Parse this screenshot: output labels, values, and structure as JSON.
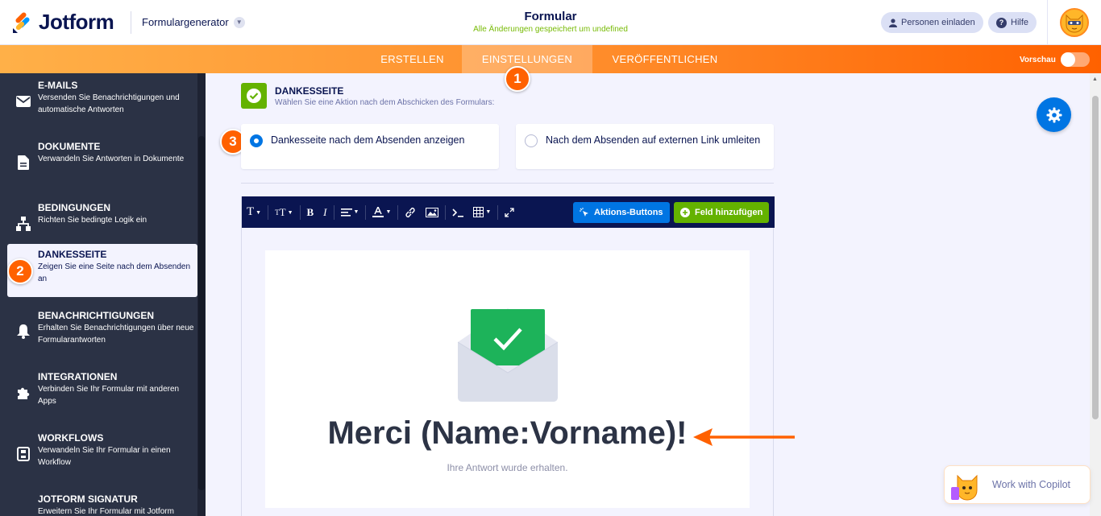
{
  "app": {
    "brand": "Jotform",
    "breadcrumb": "Formulargenerator"
  },
  "header": {
    "title": "Formular",
    "status": "Alle Änderungen gespeichert um undefined",
    "invite": "Personen einladen",
    "help": "Hilfe"
  },
  "nav": {
    "tabs": [
      {
        "label": "ERSTELLEN"
      },
      {
        "label": "EINSTELLUNGEN"
      },
      {
        "label": "VERÖFFENTLICHEN"
      }
    ],
    "preview": "Vorschau"
  },
  "callouts": [
    "1",
    "2",
    "3"
  ],
  "sidebar": {
    "items": [
      {
        "title": "E-MAILS",
        "desc": "Versenden Sie Benachrichtigungen und automatische Antworten",
        "icon": "envelope-icon"
      },
      {
        "title": "DOKUMENTE",
        "desc": "Verwandeln Sie Antworten in Dokumente",
        "icon": "document-icon"
      },
      {
        "title": "BEDINGUNGEN",
        "desc": "Richten Sie bedingte Logik ein",
        "icon": "hierarchy-icon"
      },
      {
        "title": "DANKESSEITE",
        "desc": "Zeigen Sie eine Seite nach dem Absenden an",
        "icon": "thankyou-icon"
      },
      {
        "title": "BENACHRICHTIGUNGEN",
        "desc": "Erhalten Sie Benachrichtigungen über neue Formularantworten",
        "icon": "bell-icon"
      },
      {
        "title": "INTEGRATIONEN",
        "desc": "Verbinden Sie Ihr Formular mit anderen Apps",
        "icon": "puzzle-icon"
      },
      {
        "title": "WORKFLOWS",
        "desc": "Verwandeln Sie Ihr Formular in einen Workflow",
        "icon": "workflow-icon"
      },
      {
        "title": "JOTFORM SIGNATUR",
        "desc": "Erweitern Sie Ihr Formular mit Jotform",
        "icon": "signature-icon"
      }
    ]
  },
  "section": {
    "title": "DANKESSEITE",
    "subtitle": "Wählen Sie eine Aktion nach dem Abschicken des Formulars:"
  },
  "options": [
    {
      "label": "Dankesseite nach dem Absenden anzeigen",
      "selected": true
    },
    {
      "label": "Nach dem Absenden auf externen Link umleiten",
      "selected": false
    }
  ],
  "toolbar": {
    "action_buttons": "Aktions-Buttons",
    "add_field": "Feld hinzufügen"
  },
  "thankyou": {
    "heading": "Merci (Name:Vorname)!",
    "message": "Ihre Antwort wurde erhalten."
  },
  "copilot": {
    "label": "Work with Copilot"
  },
  "colors": {
    "brand_orange": "#ff6100",
    "navy": "#0a1551",
    "sidebar": "#2b3245",
    "blue": "#0075e3",
    "green": "#64b200"
  }
}
